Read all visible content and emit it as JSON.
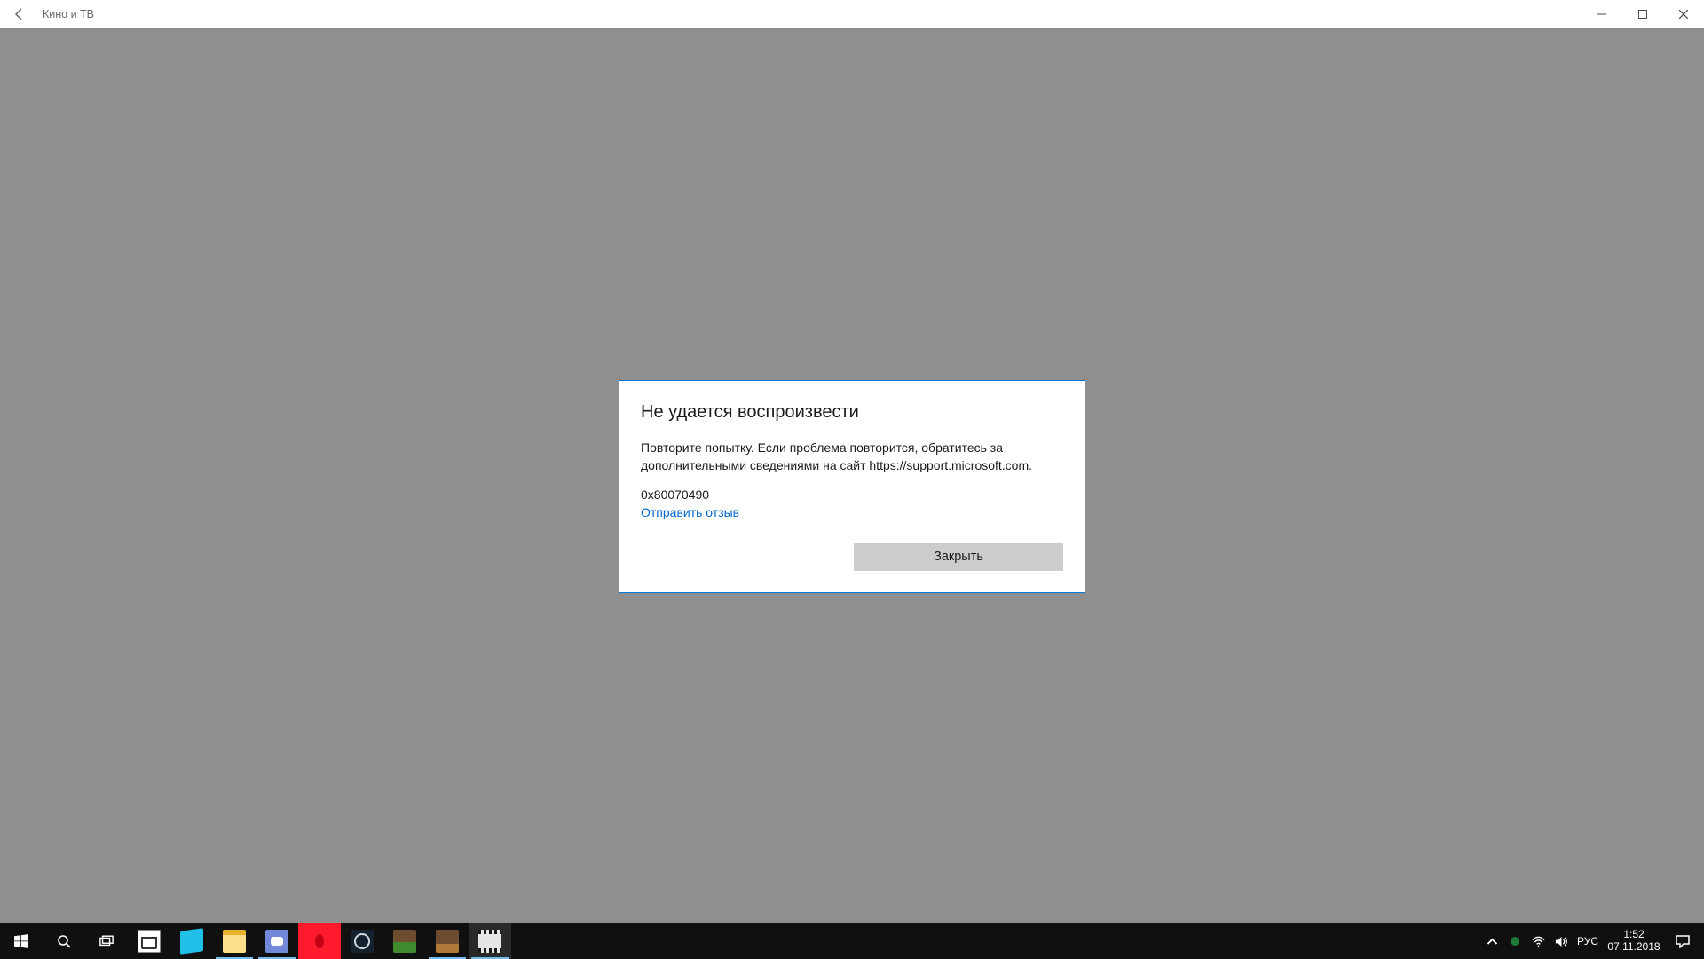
{
  "window": {
    "title": "Кино и ТВ"
  },
  "dialog": {
    "title": "Не удается воспроизвести",
    "message": "Повторите попытку. Если проблема повторится, обратитесь за дополнительными сведениями на сайт https://support.microsoft.com.",
    "error_code": "0x80070490",
    "feedback_link": "Отправить отзыв",
    "close_button": "Закрыть"
  },
  "taskbar": {
    "language": "РУС",
    "time": "1:52",
    "date": "07.11.2018"
  }
}
